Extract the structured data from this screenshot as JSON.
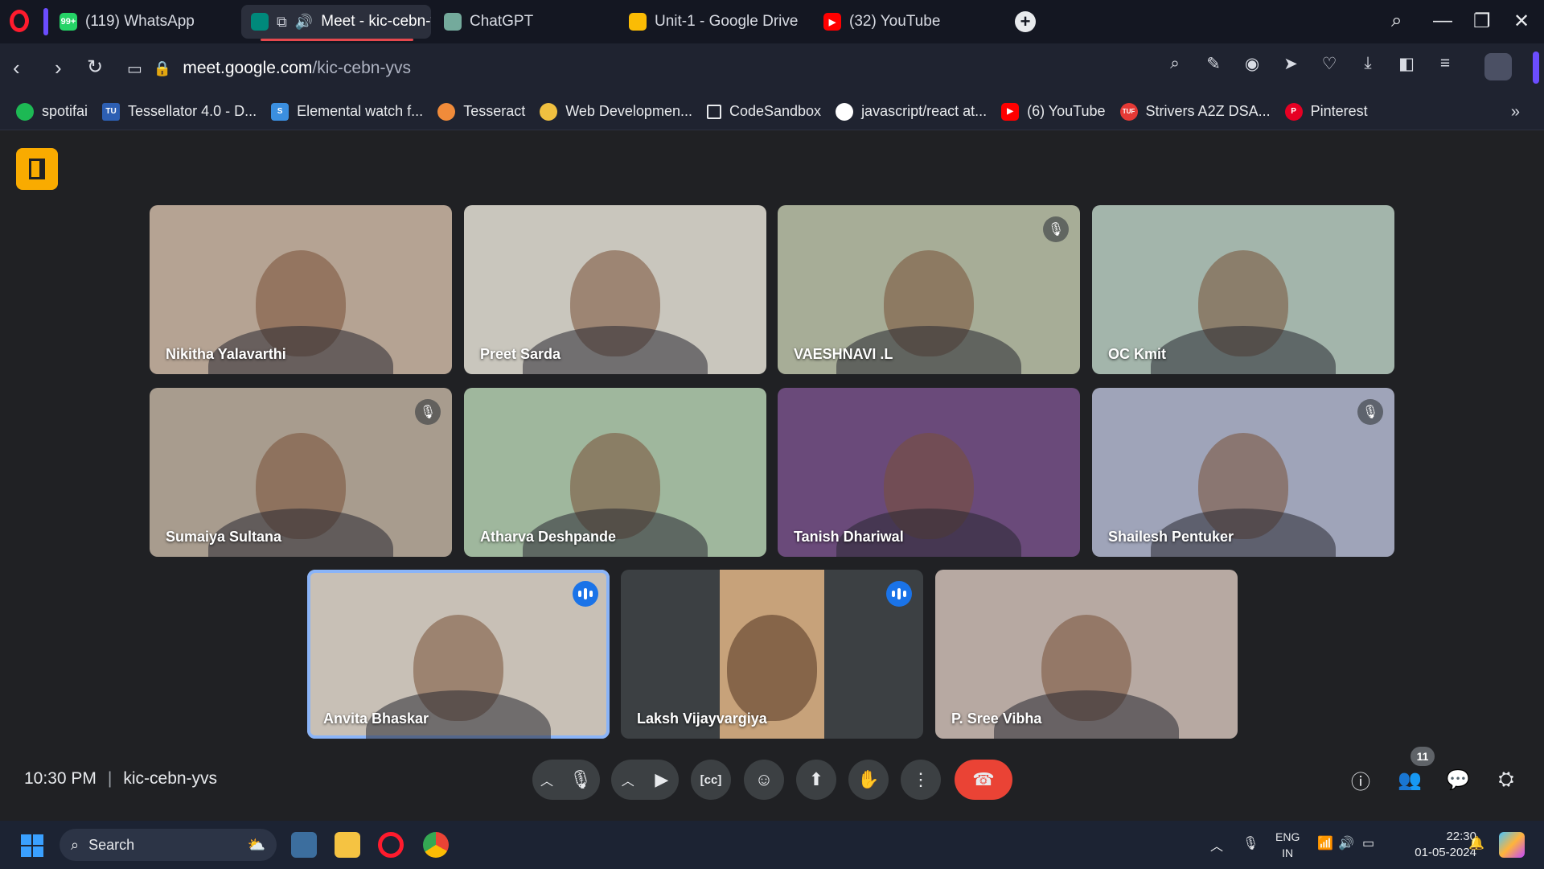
{
  "browser": {
    "tabs": [
      {
        "label": "(119) WhatsApp",
        "icon": "whatsapp-icon",
        "color": "#25d366",
        "glyph": "99+"
      },
      {
        "label": "Meet - kic-cebn-yvs",
        "icon": "google-meet-icon",
        "color": "#00897b",
        "glyph": "",
        "active": true
      },
      {
        "label": "ChatGPT",
        "icon": "chatgpt-icon",
        "color": "#74aa9c",
        "glyph": ""
      },
      {
        "label": "Unit-1 - Google Drive",
        "icon": "google-drive-icon",
        "color": "#fbbc04",
        "glyph": ""
      },
      {
        "label": "(32) YouTube",
        "icon": "youtube-icon",
        "color": "#ff0000",
        "glyph": "▶"
      }
    ],
    "url_domain": "meet.google.com",
    "url_path": "/kic-cebn-yvs"
  },
  "bookmarks": [
    {
      "label": "spotifai",
      "color": "#1db954",
      "glyph": ""
    },
    {
      "label": "Tessellator 4.0 - D...",
      "color": "#2d5fb3",
      "glyph": "TU"
    },
    {
      "label": "Elemental watch f...",
      "color": "#3b8fe0",
      "glyph": "S"
    },
    {
      "label": "Tesseract",
      "color": "#f08b3a",
      "glyph": ""
    },
    {
      "label": "Web Developmen...",
      "color": "#f0c040",
      "glyph": ""
    },
    {
      "label": "CodeSandbox",
      "color": "#1f2330",
      "glyph": ""
    },
    {
      "label": "javascript/react at...",
      "color": "#ffffff",
      "glyph": ""
    },
    {
      "label": "(6) YouTube",
      "color": "#ff0000",
      "glyph": "▶"
    },
    {
      "label": "Strivers A2Z DSA...",
      "color": "#e53935",
      "glyph": "TUF"
    },
    {
      "label": "Pinterest",
      "color": "#e60023",
      "glyph": "P"
    }
  ],
  "participants": [
    {
      "name": "Nikitha Yalavarthi",
      "bg": "#b5a393",
      "muted": false,
      "speaking": false
    },
    {
      "name": "Preet Sarda",
      "bg": "#c9c6bd",
      "muted": false,
      "speaking": false
    },
    {
      "name": "VAESHNAVI .L",
      "bg": "#a7ad97",
      "muted": true,
      "speaking": false
    },
    {
      "name": "OC Kmit",
      "bg": "#a3b5ab",
      "muted": false,
      "speaking": false
    },
    {
      "name": "Sumaiya Sultana",
      "bg": "#a89c8e",
      "muted": true,
      "speaking": false
    },
    {
      "name": "Atharva Deshpande",
      "bg": "#9fb79d",
      "muted": false,
      "speaking": false
    },
    {
      "name": "Tanish Dhariwal",
      "bg": "#6a4a7a",
      "muted": false,
      "speaking": false
    },
    {
      "name": "Shailesh Pentuker",
      "bg": "#9fa4b9",
      "muted": true,
      "speaking": false
    },
    {
      "name": "Anvita Bhaskar",
      "bg": "#c8c0b6",
      "muted": false,
      "speaking": true,
      "active": true
    },
    {
      "name": "Laksh Vijayvargiya",
      "bg": "#3c4043",
      "muted": false,
      "speaking": true
    },
    {
      "name": "P. Sree Vibha",
      "bg": "#b7a9a2",
      "muted": false,
      "speaking": false
    }
  ],
  "meeting": {
    "time": "10:30 PM",
    "code": "kic-cebn-yvs",
    "people_count": "11"
  },
  "taskbar": {
    "search_placeholder": "Search",
    "lang_line1": "ENG",
    "lang_line2": "IN",
    "clock_time": "22:30",
    "clock_date": "01-05-2024"
  }
}
